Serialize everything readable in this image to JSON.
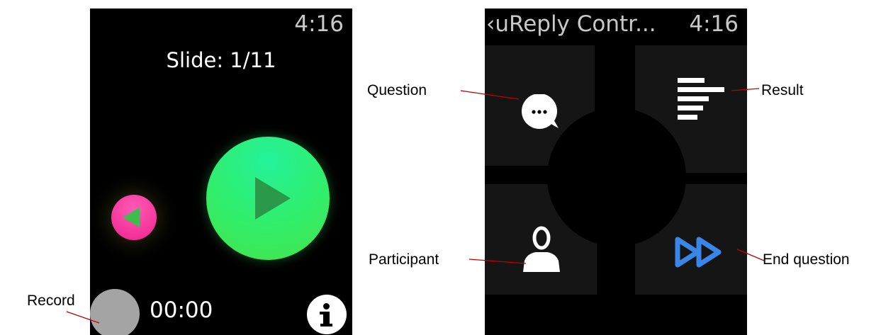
{
  "left_watch": {
    "time": "4:16",
    "slide_label": "Slide: 1/11",
    "timer": "00:00"
  },
  "right_watch": {
    "back_title": "‹uReply Contr...",
    "time": "4:16"
  },
  "labels": {
    "record": "Record",
    "question": "Question",
    "result": "Result",
    "participant": "Participant",
    "end_question": "End question"
  },
  "icons": {
    "play": "play-icon",
    "previous": "previous-slide-icon",
    "record": "record-icon",
    "info": "info-icon",
    "question": "speech-bubble-icon",
    "result": "bar-list-icon",
    "participant": "person-icon",
    "end_question": "fast-forward-icon"
  },
  "colors": {
    "play_green": "#31ee6a",
    "previous_pink": "#f0228f",
    "record_gray": "#a4a4a4",
    "fast_forward_blue": "#3a86e8",
    "leader_line": "#c00000"
  }
}
